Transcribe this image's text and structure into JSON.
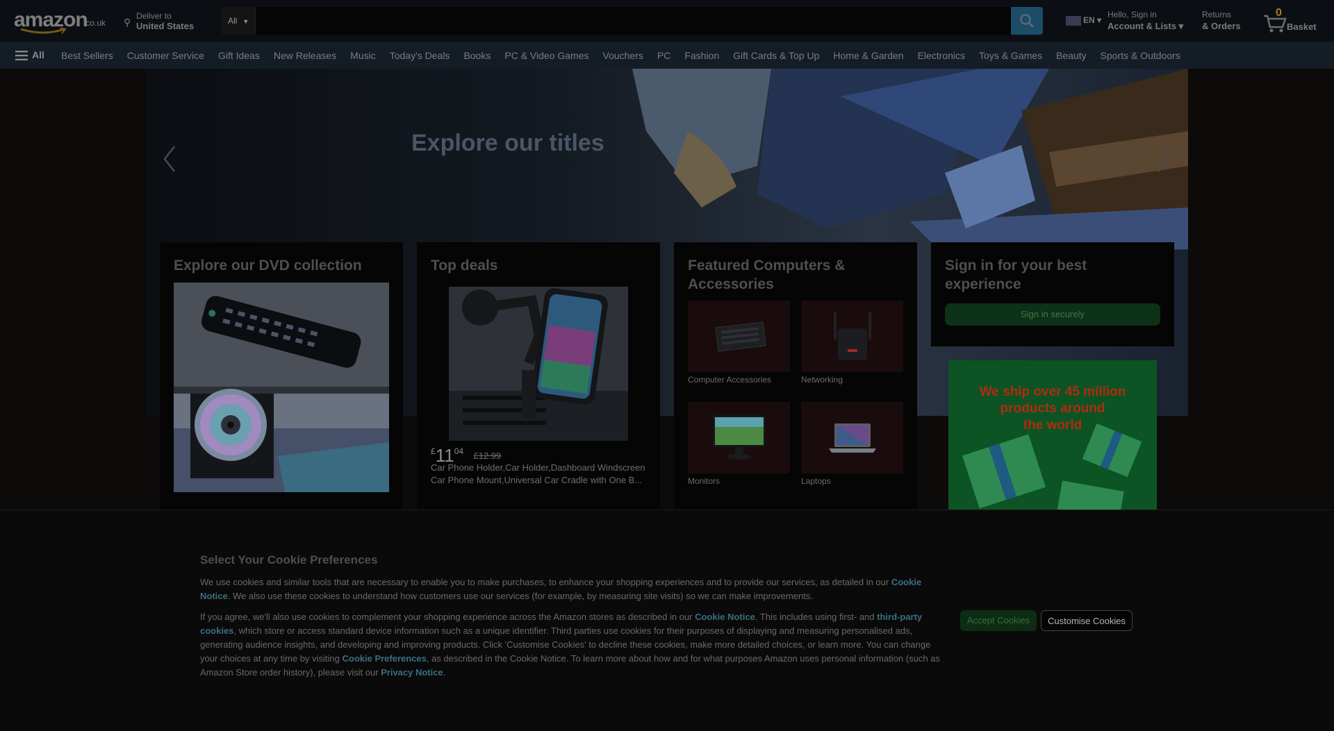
{
  "header": {
    "logo_text": "amazon",
    "logo_tld": ".co.uk",
    "deliver_line1": "Deliver to",
    "deliver_line2": "United States",
    "search_category": "All",
    "search_placeholder": "",
    "language": "EN",
    "account_line1": "Hello, Sign in",
    "account_line2": "Account & Lists",
    "returns_line1": "Returns",
    "returns_line2": "& Orders",
    "basket_count": "0",
    "basket_label": "Basket"
  },
  "nav": {
    "all_label": "All",
    "items": [
      "Best Sellers",
      "Customer Service",
      "Gift Ideas",
      "New Releases",
      "Music",
      "Today's Deals",
      "Books",
      "PC & Video Games",
      "Vouchers",
      "PC",
      "Fashion",
      "Gift Cards & Top Up",
      "Home & Garden",
      "Electronics",
      "Toys & Games",
      "Beauty",
      "Sports & Outdoors"
    ]
  },
  "hero": {
    "title": "Explore our titles"
  },
  "cards": {
    "dvd": {
      "title": "Explore our DVD collection"
    },
    "deals": {
      "title": "Top deals",
      "price_symbol": "£",
      "price_whole": "11",
      "price_fraction": "04",
      "price_old": "£12.99",
      "product_title": "Car Phone Holder,Car Holder,Dashboard Windscreen Car Phone Mount,Universal Car Cradle with One B..."
    },
    "computers": {
      "title": "Featured Computers & Accessories",
      "tiles": [
        {
          "label": "Computer Accessories",
          "icon": "keyboard-icon"
        },
        {
          "label": "Networking",
          "icon": "router-icon"
        },
        {
          "label": "Monitors",
          "icon": "monitor-icon"
        },
        {
          "label": "Laptops",
          "icon": "laptop-icon"
        }
      ]
    },
    "signin": {
      "title": "Sign in for your best experience",
      "button": "Sign in securely"
    },
    "promo": {
      "line1": "We ship over 45 million",
      "line2": "products around",
      "line3": "the world"
    }
  },
  "cookie": {
    "title": "Select Your Cookie Preferences",
    "p1_a": "We use cookies and similar tools that are necessary to enable you to make purchases, to enhance your shopping experiences and to provide our services, as detailed in our ",
    "p1_link": "Cookie Notice",
    "p1_b": ". We also use these cookies to understand how customers use our services (for example, by measuring site visits) so we can make improvements.",
    "p2_a": "If you agree, we'll also use cookies to complement your shopping experience across the Amazon stores as described in our ",
    "p2_link1": "Cookie Notice",
    "p2_b": ". This includes using first- and ",
    "p2_link2": "third-party cookies",
    "p2_c": ", which store or access standard device information such as a unique identifier. Third parties use cookies for their purposes of displaying and measuring personalised ads, generating audience insights, and developing and improving products. Click 'Customise Cookies' to decline these cookies, make more detailed choices, or learn more. You can change your choices at any time by visiting ",
    "p2_link3": "Cookie Preferences",
    "p2_d": ", as described in the Cookie Notice. To learn more about how and for what purposes Amazon uses personal information (such as Amazon Store order history), please visit our ",
    "p2_link4": "Privacy Notice",
    "p2_e": ".",
    "accept_label": "Accept Cookies",
    "customise_label": "Customise Cookies"
  }
}
